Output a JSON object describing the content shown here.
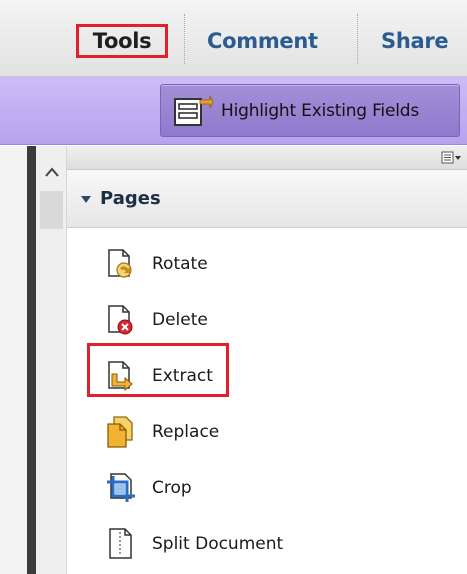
{
  "tabs": {
    "tools": "Tools",
    "comment": "Comment",
    "share": "Share"
  },
  "toolbar": {
    "highlight_fields": "Highlight Existing Fields",
    "highlight_fields_icon": "highlight-fields-icon"
  },
  "panel": {
    "section_title": "Pages",
    "section_expanded": true,
    "items": [
      {
        "label": "Rotate",
        "icon": "rotate-page-icon"
      },
      {
        "label": "Delete",
        "icon": "delete-page-icon"
      },
      {
        "label": "Extract",
        "icon": "extract-page-icon"
      },
      {
        "label": "Replace",
        "icon": "replace-page-icon"
      },
      {
        "label": "Crop",
        "icon": "crop-page-icon"
      },
      {
        "label": "Split Document",
        "icon": "split-document-icon"
      }
    ]
  },
  "colors": {
    "highlight_outline": "#e0202c",
    "toolbar_purple": "#b7a2ee",
    "tab_blue": "#2c5b8f"
  }
}
